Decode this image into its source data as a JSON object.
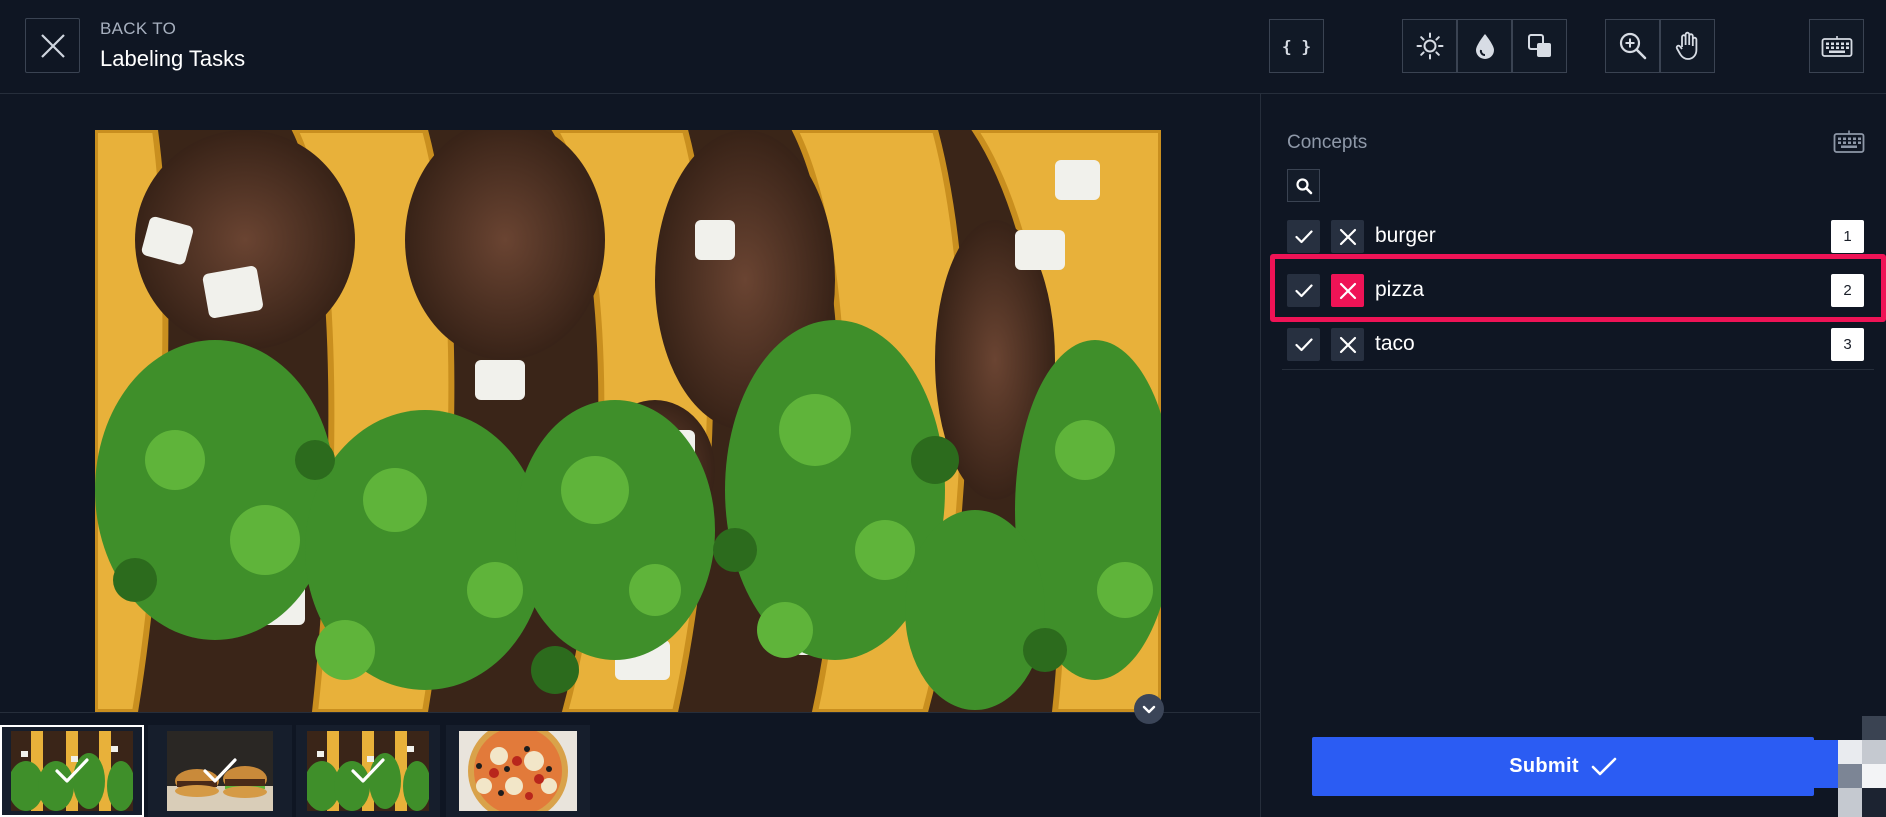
{
  "header": {
    "close_icon": "close-icon",
    "back_small": "BACK TO",
    "back_title": "Labeling Tasks",
    "tools": {
      "json": "{ }",
      "brightness_icon": "sun-icon",
      "saturation_icon": "drop-icon",
      "contrast_icon": "contrast-icon",
      "zoom_icon": "zoom-in-icon",
      "pan_icon": "hand-icon",
      "keyboard_icon": "keyboard-icon"
    }
  },
  "main": {
    "image_subject": "tacos",
    "collapse_icon": "chevron-down-icon"
  },
  "thumbnails": [
    {
      "subject": "tacos",
      "checked": true,
      "selected": true
    },
    {
      "subject": "burgers",
      "checked": true,
      "selected": false
    },
    {
      "subject": "tacos",
      "checked": true,
      "selected": false
    },
    {
      "subject": "pizza",
      "checked": false,
      "selected": false
    }
  ],
  "sidebar": {
    "title": "Concepts",
    "search_icon": "search-icon",
    "concepts": [
      {
        "label": "burger",
        "key": "1",
        "rejected": false
      },
      {
        "label": "pizza",
        "key": "2",
        "rejected": true
      },
      {
        "label": "taco",
        "key": "3",
        "rejected": false
      }
    ],
    "submit_label": "Submit"
  },
  "colors": {
    "background": "#0f1623",
    "accent_blue": "#2b5cf3",
    "reject_pink": "#ef1356"
  }
}
